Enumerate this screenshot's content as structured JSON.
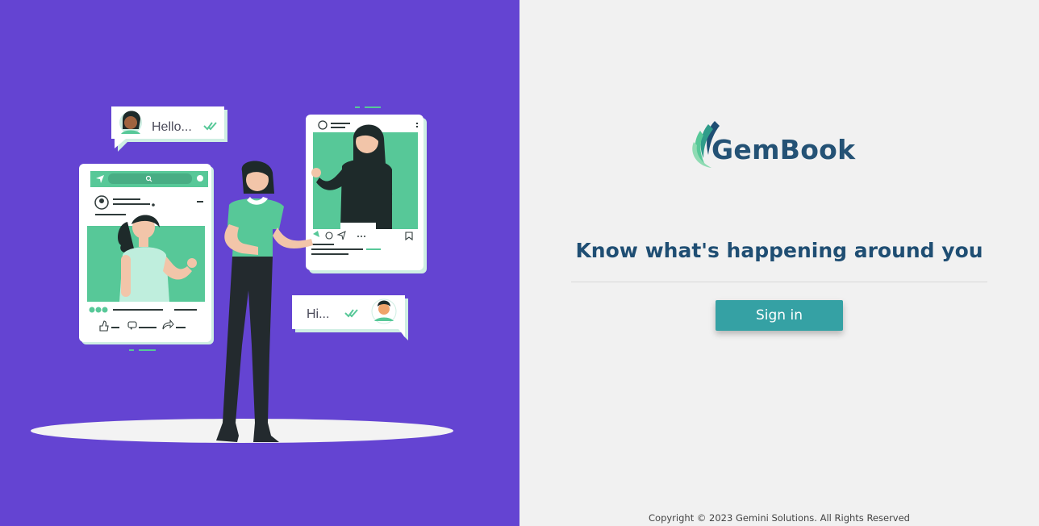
{
  "illustration": {
    "bubble_left_text": "Hello...",
    "bubble_right_text": "Hi..."
  },
  "brand": {
    "name": "GemBook"
  },
  "tagline": "Know what's happening around you",
  "sign_in_label": "Sign in",
  "footer": {
    "copyright": "Copyright © 2023 Gemini Solutions. All Rights Reserved"
  },
  "colors": {
    "left_background": "#6444d2",
    "right_background": "#f1f1f1",
    "brand_text": "#245275",
    "button": "#35a1a4",
    "illustration_green": "#57c898"
  },
  "icons": [
    "double-check-icon",
    "search-icon",
    "send-icon",
    "like-icon",
    "comment-icon",
    "share-icon",
    "bookmark-icon",
    "leaf-logo-icon"
  ]
}
